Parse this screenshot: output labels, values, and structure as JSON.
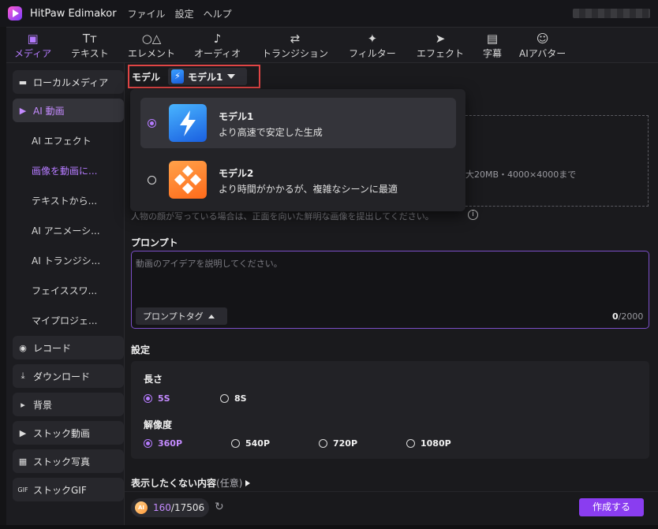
{
  "app": {
    "title": "HitPaw Edimakor",
    "menu": [
      "ファイル",
      "設定",
      "ヘルプ"
    ]
  },
  "toolbar": {
    "items": [
      {
        "label": "メディア",
        "icon": "media-icon",
        "active": true
      },
      {
        "label": "テキスト",
        "icon": "text-icon"
      },
      {
        "label": "エレメント",
        "icon": "elements-icon"
      },
      {
        "label": "オーディオ",
        "icon": "audio-icon"
      },
      {
        "label": "トランジション",
        "icon": "transition-icon"
      },
      {
        "label": "フィルター",
        "icon": "filter-icon"
      },
      {
        "label": "エフェクト",
        "icon": "effect-icon"
      },
      {
        "label": "字幕",
        "icon": "subtitle-icon"
      },
      {
        "label": "AIアバター",
        "icon": "avatar-icon"
      }
    ]
  },
  "sidebar": {
    "local_media": "ローカルメディア",
    "ai_video": "AI 動画",
    "sub_items": [
      "AI エフェクト",
      "画像を動画に...",
      "テキストから...",
      "AI アニメーシ...",
      "AI トランジシ...",
      "フェイススワ...",
      "マイプロジェ..."
    ],
    "record": "レコード",
    "download": "ダウンロード",
    "background": "背景",
    "stock_video": "ストック動画",
    "stock_photo": "ストック写真",
    "stock_gif": "ストックGIF"
  },
  "model": {
    "label": "モデル",
    "selected": "モデル1",
    "options": [
      {
        "name": "モデル1",
        "desc": "より高速で安定した生成"
      },
      {
        "name": "モデル2",
        "desc": "より時間がかかるが、複雑なシーンに最適"
      }
    ]
  },
  "upload": {
    "hint": "大20MB・4000×4000まで",
    "face_note": "人物の顔が写っている場合は、正面を向いた鮮明な画像を提出してください。"
  },
  "prompt": {
    "title": "プロンプト",
    "placeholder": "動画のアイデアを説明してください。",
    "tag_button": "プロンプトタグ",
    "count": "0",
    "max": "/2000"
  },
  "settings": {
    "title": "設定",
    "length_label": "長さ",
    "length_options": [
      "5S",
      "8S"
    ],
    "length_selected": "5S",
    "resolution_label": "解像度",
    "resolution_options": [
      "360P",
      "540P",
      "720P",
      "1080P"
    ],
    "resolution_selected": "360P"
  },
  "exclude": {
    "label": "表示したくない内容",
    "optional": "(任意)"
  },
  "footer": {
    "coin_label": "AI",
    "credits_used": "160",
    "credits_total": "/17506",
    "create_button": "作成する"
  },
  "colors": {
    "accent": "#b57bff",
    "button": "#8a3df0",
    "highlight_border": "#e04545"
  }
}
